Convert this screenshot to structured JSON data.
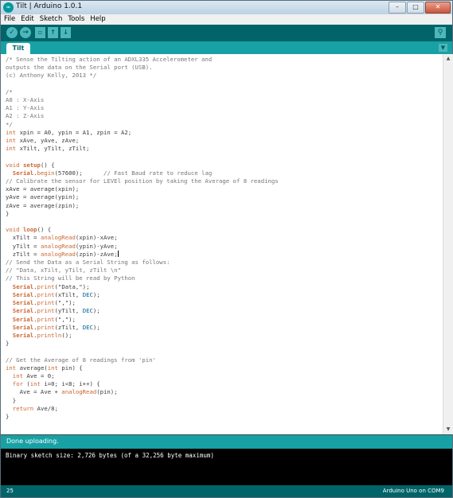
{
  "window": {
    "title": "Tilt | Arduino 1.0.1",
    "icon_text": "∞",
    "controls": [
      "–",
      "□",
      "✕"
    ]
  },
  "menu": [
    "File",
    "Edit",
    "Sketch",
    "Tools",
    "Help"
  ],
  "toolbar": {
    "verify_icon": "checkmark-icon",
    "upload_icon": "arrow-right-icon",
    "new_icon": "new-file-icon",
    "open_icon": "open-icon",
    "save_icon": "save-icon",
    "serial_monitor_icon": "magnifier-icon"
  },
  "tabs": [
    {
      "label": "Tilt"
    }
  ],
  "code_lines": [
    "/* Sense the Tilting action of an ADXL335 Accelerometer and",
    "outputs the data on the Serial port (USB).",
    "(c) Anthony Kelly, 2013 */",
    "",
    "/*",
    "A0 : X-Axis",
    "A1 : Y-Axis",
    "A2 : Z-Axis",
    "*/",
    "int xpin = A0, ypin = A1, zpin = A2;",
    "int xAve, yAve, zAve;",
    "int xTilt, yTilt, zTilt;",
    "",
    "void setup() {",
    "  Serial.begin(57600);      // Fast Baud rate to reduce lag",
    "// Calibrate the sensor for LEVEl position by taking the Average of 8 readings",
    "xAve = average(xpin);",
    "yAve = average(ypin);",
    "zAve = average(zpin);",
    "}",
    "",
    "void loop() {",
    "  xTilt = analogRead(xpin)-xAve;",
    "  yTilt = analogRead(ypin)-yAve;",
    "  zTilt = analogRead(zpin)-zAve;",
    "// Send the Data as a Serial String as follows:",
    "// \"Data, xTilt, yTilt, zTilt \\n\"",
    "// This String will be read by Python",
    "  Serial.print(\"Data,\");",
    "  Serial.print(xTilt, DEC);",
    "  Serial.print(\",\");",
    "  Serial.print(yTilt, DEC);",
    "  Serial.print(\",\");",
    "  Serial.print(zTilt, DEC);",
    "  Serial.println();",
    "}",
    "",
    "// Get the Average of 8 readings from 'pin'",
    "int average(int pin) {",
    "  int Ave = 0;",
    "  for (int i=0; i<8; i++) {",
    "    Ave = Ave + analogRead(pin);",
    "  }",
    "  return Ave/8;",
    "}"
  ],
  "status": "Done uploading.",
  "console": "Binary sketch size: 2,726 bytes (of a 32,256 byte maximum)",
  "footer": {
    "line": "25",
    "board": "Arduino Uno on COM9"
  },
  "colors": {
    "teal_dark": "#006468",
    "teal": "#17a1a5",
    "keyword": "#cc6633",
    "type": "#006699",
    "comment": "#777777"
  }
}
